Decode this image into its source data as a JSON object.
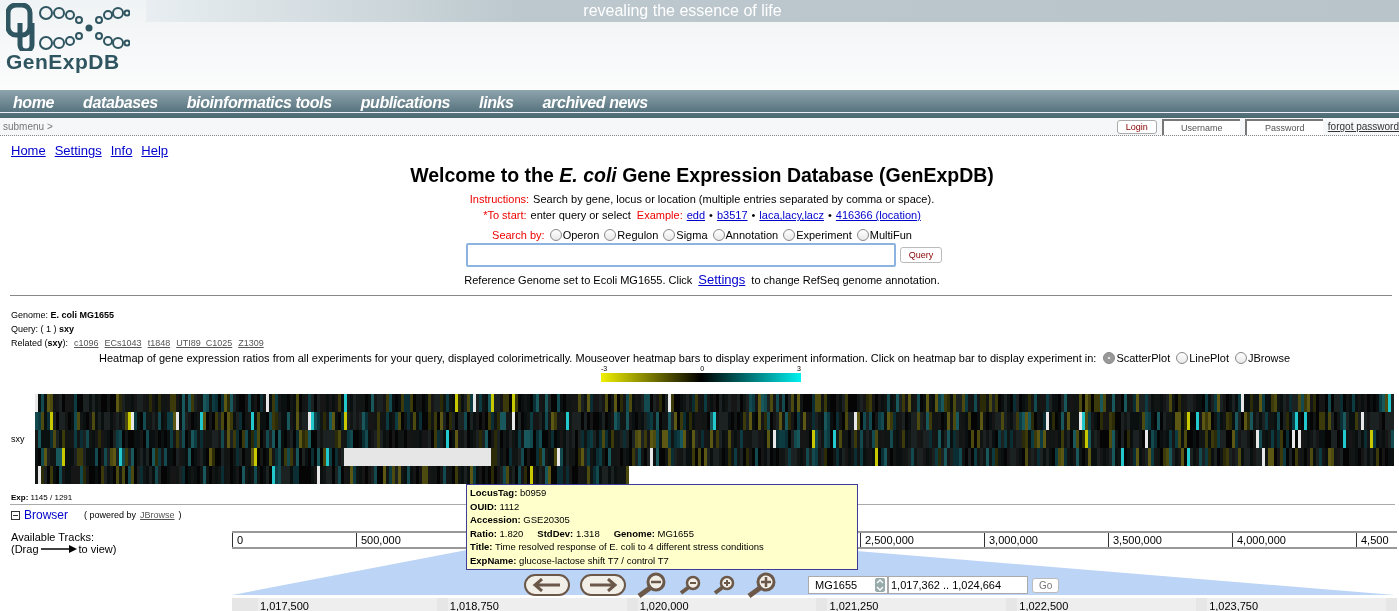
{
  "header": {
    "logo_text": "GenExpDB",
    "tagline": "revealing the essence of life"
  },
  "nav": {
    "items": [
      {
        "label": "home"
      },
      {
        "label": "databases"
      },
      {
        "label": "bioinformatics tools"
      },
      {
        "label": "publications"
      },
      {
        "label": "links"
      },
      {
        "label": "archived news"
      }
    ]
  },
  "submenu": {
    "label": "submenu >"
  },
  "login": {
    "button": "Login",
    "username_placeholder": "Username",
    "password_placeholder": "Password",
    "forgot": "forgot password"
  },
  "top_links": [
    "Home",
    "Settings",
    "Info",
    "Help"
  ],
  "title": "Welcome to the *E. coli* Gene Expression Database (GenExpDB)",
  "instructions": {
    "label": "Instructions:",
    "text": "Search by gene, locus or location (multiple entries separated by comma or space)."
  },
  "to_start": {
    "label": "*To start:",
    "text": "enter query or select",
    "example_label": "Example:",
    "examples": [
      "edd",
      "b3517",
      "laca,lacy,lacz",
      "416366 (location)"
    ],
    "separator": "•"
  },
  "search_by": {
    "label": "Search by:",
    "options": [
      {
        "label": "Operon",
        "selected": false
      },
      {
        "label": "Regulon",
        "selected": false
      },
      {
        "label": "Sigma",
        "selected": false
      },
      {
        "label": "Annotation",
        "selected": false
      },
      {
        "label": "Experiment",
        "selected": false
      },
      {
        "label": "MultiFun",
        "selected": false
      }
    ]
  },
  "query": {
    "button": "Query"
  },
  "refseq": {
    "before": "Reference Genome set to Ecoli MG1655. Click",
    "link": "Settings",
    "after": "to change RefSeq genome annotation."
  },
  "results": {
    "genome": "Genome: **E. coli MG1655**",
    "query": "Query: ( 1 ) **sxy**",
    "related_label": "Related (**sxy**):",
    "related": [
      "c1096",
      "ECs1043",
      "t1848",
      "UTI89_C1025",
      "Z1309"
    ]
  },
  "heatmap": {
    "caption": "Heatmap of gene expression ratios from all experiments for your query, displayed colorimetrically. Mouseover heatmap bars to display experiment information. Click on heatmap bar to display experiment in:",
    "display_options": [
      {
        "label": "ScatterPlot",
        "selected": true
      },
      {
        "label": "LinePlot",
        "selected": false
      },
      {
        "label": "JBrowse",
        "selected": false
      }
    ],
    "scale_labels": [
      "-3",
      "0",
      "3"
    ],
    "row_label": "sxy",
    "exp": "**Exp:** 1145 / 1291"
  },
  "tooltip": {
    "lines": [
      [
        {
          "label": "LocusTag:",
          "value": "b0959"
        }
      ],
      [
        {
          "label": "OUID:",
          "value": "1112"
        }
      ],
      [
        {
          "label": "Accession:",
          "value": "GSE20305"
        }
      ],
      [
        {
          "label": "Ratio:",
          "value": "1.820"
        },
        {
          "label": "StdDev:",
          "value": "1.318"
        },
        {
          "label": "Genome:",
          "value": "MG1655"
        }
      ],
      [
        {
          "label": "Title:",
          "value": "Time resolved response of E. coli to 4 different stress conditions"
        }
      ],
      [
        {
          "label": "ExpName:",
          "value": "glucose-lactose shift T7 / control T7"
        }
      ]
    ]
  },
  "browser": {
    "expanded": true,
    "label": "Browser",
    "powered_before": "( powered by",
    "powered_link": "JBrowse",
    "powered_after": ")",
    "tracks_label": "Available Tracks:",
    "drag_before": "(Drag",
    "drag_after": "to view)",
    "overview_ticks": [
      "0",
      "500,000",
      "2,500,000",
      "3,000,000",
      "3,500,000",
      "4,000,000",
      "4,500"
    ],
    "genome_select": "MG1655",
    "location": "1,017,362 .. 1,024,664",
    "go": "Go",
    "detail_ticks": [
      "1,017,500",
      "1,018,750",
      "1,020,000",
      "1,021,250",
      "1,022,500",
      "1,023,750"
    ]
  }
}
